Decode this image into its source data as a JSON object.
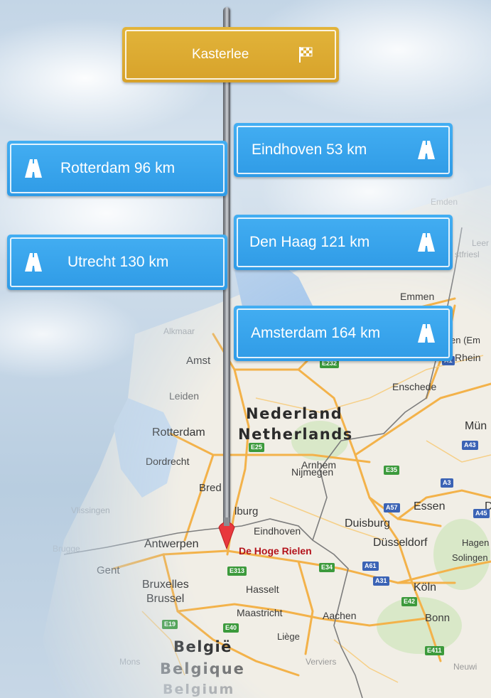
{
  "destination": {
    "name": "Kasterlee",
    "flag_icon": "checkered-flag-icon",
    "color": "#d9a42b"
  },
  "signs": [
    {
      "label": "Rotterdam 96 km",
      "icon": "highway-icon"
    },
    {
      "label": "Eindhoven 53 km",
      "icon": "highway-icon"
    },
    {
      "label": "Utrecht 130 km",
      "icon": "highway-icon"
    },
    {
      "label": "Den Haag 121 km",
      "icon": "highway-icon"
    },
    {
      "label": "Amsterdam 164 km",
      "icon": "highway-icon"
    }
  ],
  "sign_color": "#369fe9",
  "map": {
    "countries": [
      "Nederland",
      "Netherlands",
      "België",
      "Belgique",
      "Belgium"
    ],
    "marker_label": "De Hoge Rielen",
    "cities": [
      "Amst",
      "Leiden",
      "Rotterdam",
      "Dordrecht",
      "Bred",
      "lburg",
      "Eindhoven",
      "Arnhem",
      "Nijmegen",
      "Enschede",
      "Emmen",
      "Duisburg",
      "Essen",
      "Düsseldorf",
      "Köln",
      "Bonn",
      "Aachen",
      "Hasselt",
      "Maastricht",
      "Liège",
      "Antwerpen",
      "Gent",
      "Bruxelles",
      "Brussel",
      "Verviers",
      "Mons",
      "Hagen",
      "Solingen",
      "Mün",
      "Rhein",
      "en (Em",
      "Leer",
      "stfriesl",
      "Alkmaar",
      "Emden",
      "Vlissingen",
      "Brugge",
      "Neuwi",
      "D"
    ],
    "roads": [
      "E25",
      "E232",
      "E35",
      "E313",
      "E40",
      "E19",
      "E34",
      "E42",
      "E411",
      "A1",
      "A57",
      "A3",
      "A31",
      "A43",
      "A61",
      "A45"
    ],
    "colors": {
      "road": "#f3b24a",
      "land": "#f1eee6",
      "water": "#a9c9ec",
      "border": "#7d7d7d",
      "marker": "#e8383d"
    }
  }
}
